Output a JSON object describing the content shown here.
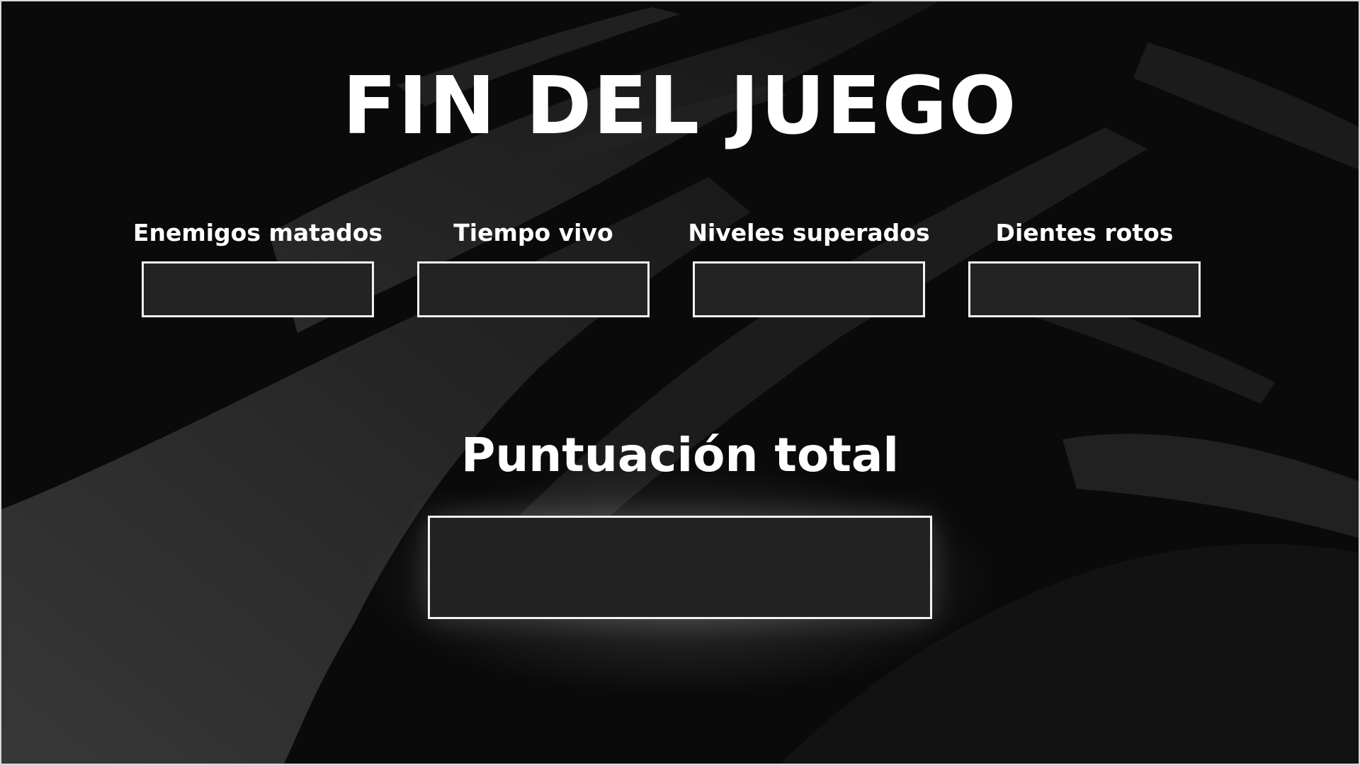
{
  "screen": {
    "title": "FIN DEL JUEGO",
    "background_color": "#0a0a0a",
    "accent_color": "#ffffff",
    "box_fill_color": "#232323"
  },
  "stats": [
    {
      "label": "Enemigos matados",
      "value": ""
    },
    {
      "label": "Tiempo vivo",
      "value": ""
    },
    {
      "label": "Niveles superados",
      "value": ""
    },
    {
      "label": "Dientes rotos",
      "value": ""
    }
  ],
  "total": {
    "label": "Puntuación total",
    "value": ""
  }
}
